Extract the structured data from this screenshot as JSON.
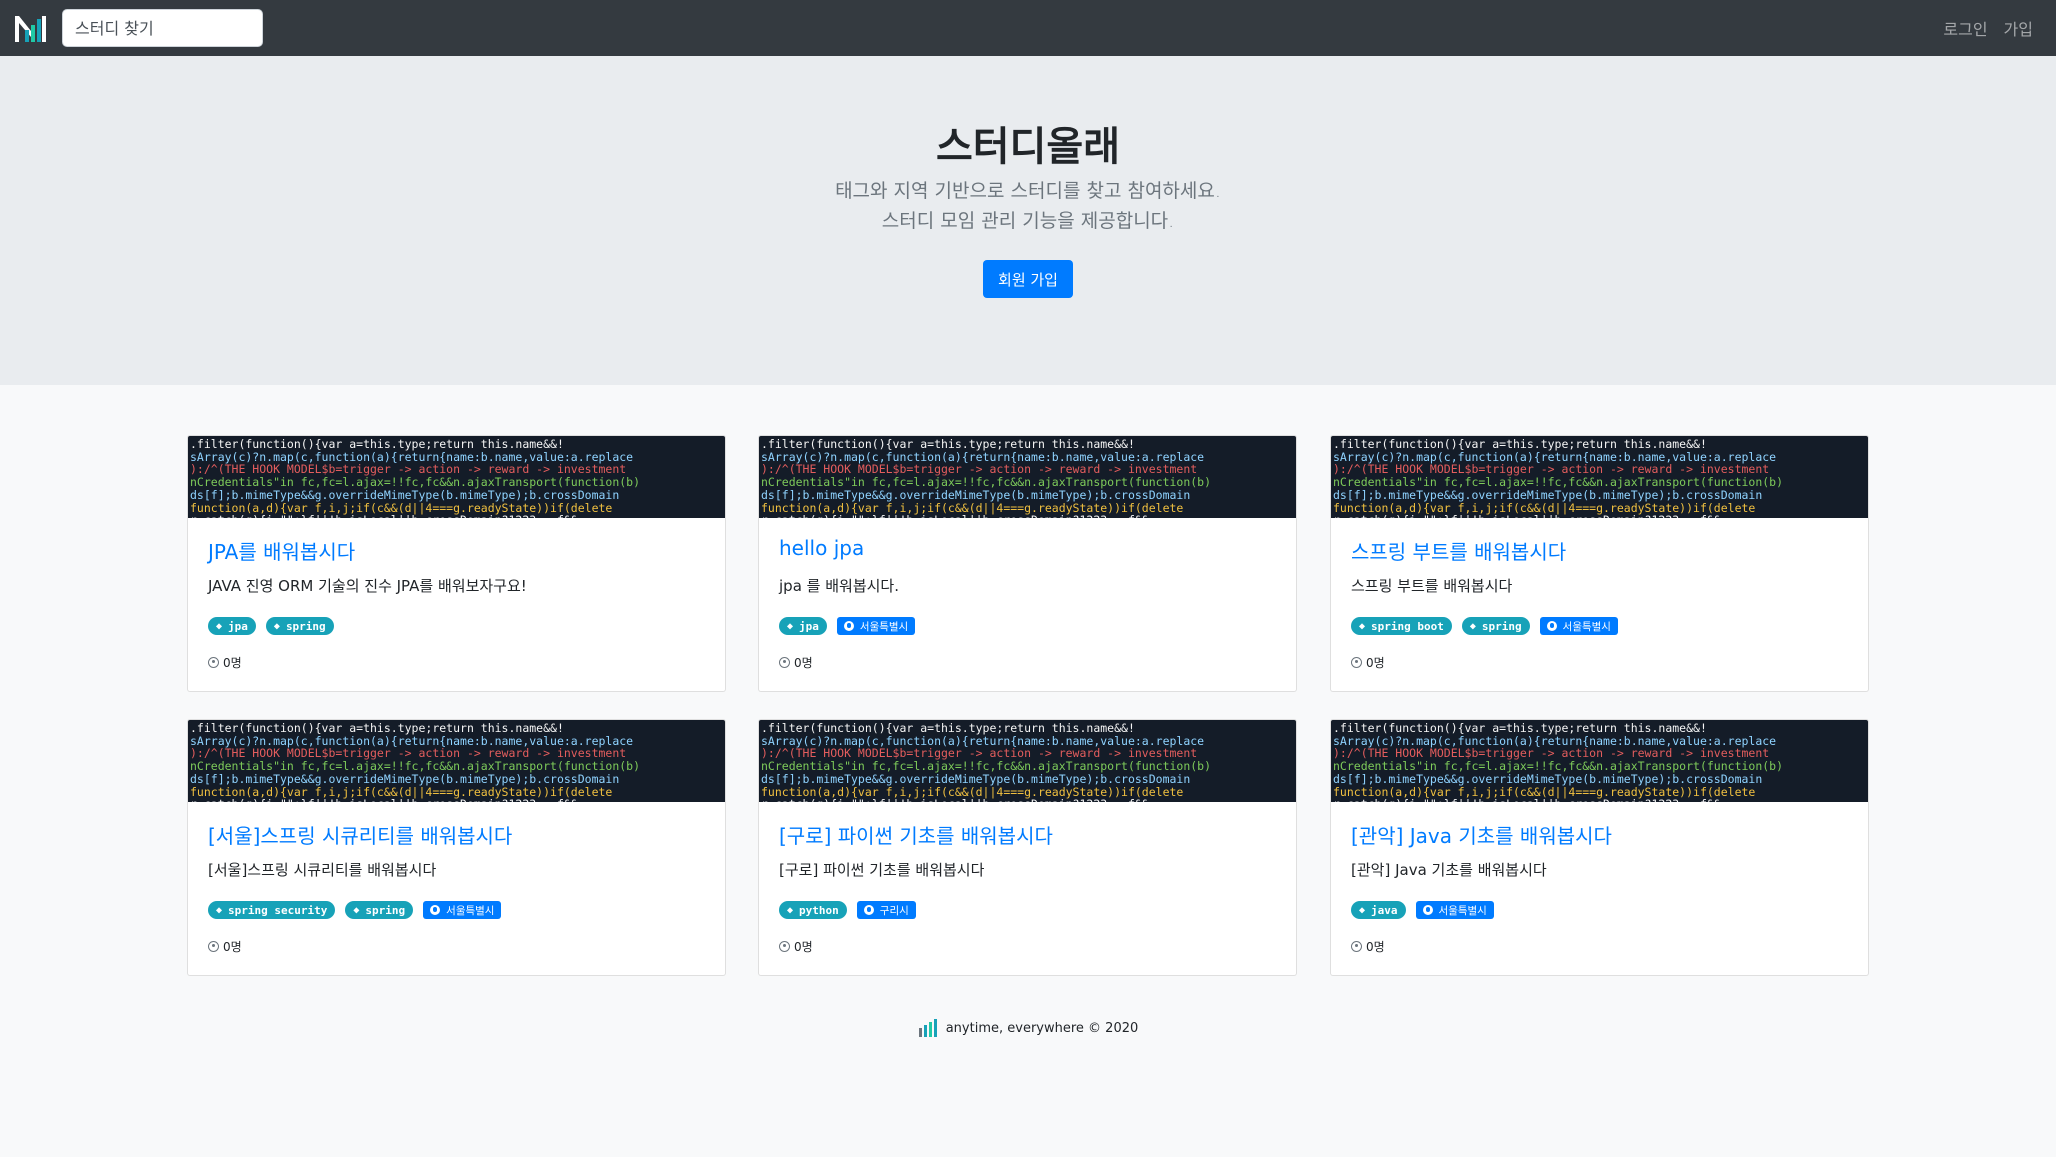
{
  "navbar": {
    "search_placeholder": "스터디 찾기",
    "login_label": "로그인",
    "signup_label": "가입"
  },
  "hero": {
    "title": "스터디올래",
    "lead_line1": "태그와 지역 기반으로 스터디를 찾고 참여하세요.",
    "lead_line2": "스터디 모임 관리 기능을 제공합니다.",
    "signup_button": "회원 가입"
  },
  "cards": [
    {
      "title": "JPA를 배워봅시다",
      "text": "JAVA 진영 ORM 기술의 진수 JPA를 배워보자구요!",
      "tags": [
        "jpa",
        "spring"
      ],
      "zones": [],
      "members": "0명"
    },
    {
      "title": "hello jpa",
      "text": "jpa 를 배워봅시다.",
      "tags": [
        "jpa"
      ],
      "zones": [
        "서울특별시"
      ],
      "members": "0명"
    },
    {
      "title": "스프링 부트를 배워봅시다",
      "text": "스프링 부트를 배워봅시다",
      "tags": [
        "spring boot",
        "spring"
      ],
      "zones": [
        "서울특별시"
      ],
      "members": "0명"
    },
    {
      "title": "[서울]스프링 시큐리티를 배워봅시다",
      "text": "[서울]스프링 시큐리티를 배워봅시다",
      "tags": [
        "spring security",
        "spring"
      ],
      "zones": [
        "서울특별시"
      ],
      "members": "0명"
    },
    {
      "title": "[구로] 파이썬 기초를 배워봅시다",
      "text": "[구로] 파이썬 기초를 배워봅시다",
      "tags": [
        "python"
      ],
      "zones": [
        "구리시"
      ],
      "members": "0명"
    },
    {
      "title": "[관악] Java 기초를 배워봅시다",
      "text": "[관악] Java 기초를 배워봅시다",
      "tags": [
        "java"
      ],
      "zones": [
        "서울특별시"
      ],
      "members": "0명"
    }
  ],
  "footer": {
    "text": "anytime, everywhere © 2020"
  },
  "colors": {
    "navbar_bg": "#343a40",
    "hero_bg": "#e9ecef",
    "primary": "#007bff",
    "tag_bg": "#17a2b8"
  },
  "icons": {
    "logo": "bar-logo-icon",
    "tag": "tag-icon",
    "zone": "globe-icon",
    "members": "user-circle-icon"
  }
}
